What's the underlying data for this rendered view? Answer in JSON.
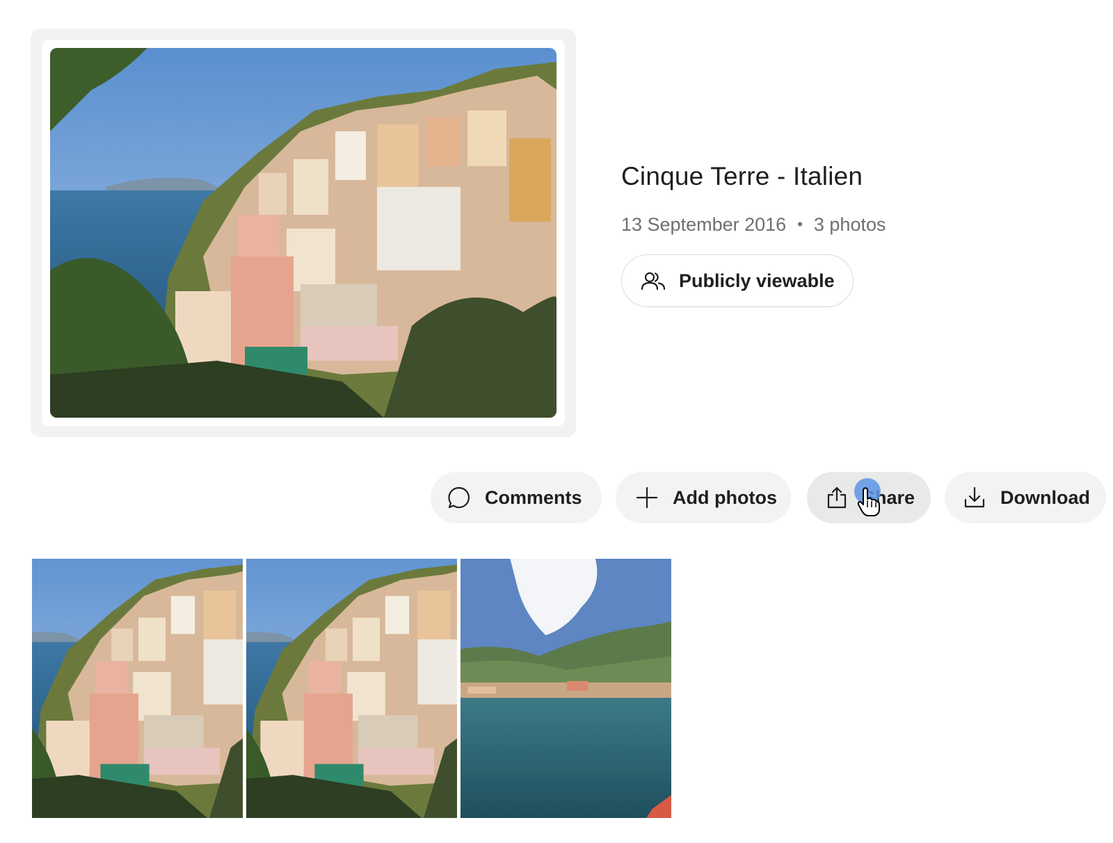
{
  "album": {
    "title": "Cinque Terre - Italien",
    "date": "13 September 2016",
    "separator": "•",
    "photo_count": "3 photos",
    "visibility_label": "Publicly viewable",
    "visibility_icon": "users-icon"
  },
  "actions": [
    {
      "label": "Comments",
      "icon": "speech-bubble-icon"
    },
    {
      "label": "Add photos",
      "icon": "plus-icon"
    },
    {
      "label": "Share",
      "icon": "share-icon"
    },
    {
      "label": "Download",
      "icon": "download-icon"
    }
  ],
  "photos": [
    {
      "scene": "village-hillside"
    },
    {
      "scene": "village-hillside"
    },
    {
      "scene": "bay-with-beach"
    }
  ],
  "colors": {
    "button_bg": "#f3f3f3",
    "button_hover_bg": "#e9e9e9",
    "meta_text": "#6f6f6f",
    "cursor_highlight": "#5c95e6"
  }
}
